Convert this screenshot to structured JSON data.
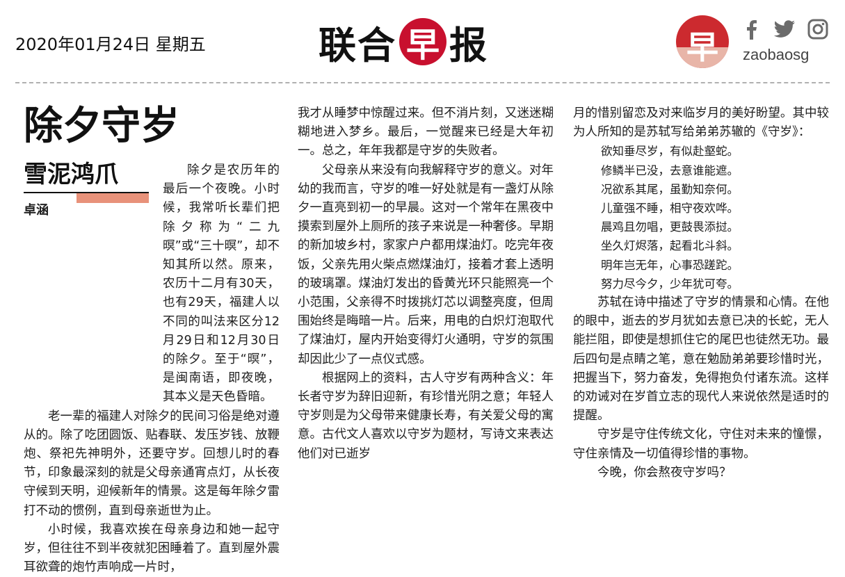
{
  "header": {
    "date": "2020年01月24日 星期五",
    "masthead": {
      "left": "联合",
      "circle": "早",
      "right": "报"
    },
    "logo_char": "早",
    "handle": "zaobaosg",
    "social_icons": [
      "facebook-icon",
      "twitter-icon",
      "instagram-icon"
    ]
  },
  "article": {
    "title": "除夕守岁",
    "column": "雪泥鸿爪",
    "author": "卓涵",
    "col1": [
      "除夕是农历年的最后一个夜晚。小时候，我常听长辈们把除夕称为“二九暝”或“三十暝”，却不知其所以然。原来，农历十二月有30天，也有29天，福建人以不同的叫法来区分12月29日和12月30日的除夕。至于“暝”，是闽南语，即夜晚，其本义是天色昏暗。",
      "老一辈的福建人对除夕的民间习俗是绝对遵从的。除了吃团圆饭、贴春联、发压岁钱、放鞭炮、祭祀先神明外，还要守岁。回想儿时的春节，印象最深刻的就是父母亲通宵点灯，从长夜守候到天明，迎候新年的情景。这是每年除夕雷打不动的惯例，直到母亲逝世为止。",
      "小时候，我喜欢挨在母亲身边和她一起守岁，但往往不到半夜就犯困睡着了。直到屋外震耳欲聋的炮竹声响成一片时，"
    ],
    "col2": [
      "我才从睡梦中惊醒过来。但不消片刻，又迷迷糊糊地进入梦乡。最后，一觉醒来已经是大年初一。总之，年年我都是守岁的失败者。",
      "父母亲从来没有向我解释守岁的意义。对年幼的我而言，守岁的唯一好处就是有一盏灯从除夕一直亮到初一的早晨。这对一个常年在黑夜中摸索到屋外上厕所的孩子来说是一种奢侈。早期的新加坡乡村，家家户户都用煤油灯。吃完年夜饭，父亲先用火柴点燃煤油灯，接着才套上透明的玻璃罩。煤油灯发出的昏黄光环只能照亮一个小范围，父亲得不时拨挑灯芯以调整亮度，但周围始终是晦暗一片。后来，用电的白炽灯泡取代了煤油灯，屋内开始变得灯火通明，守岁的氛围却因此少了一点仪式感。",
      "根据网上的资料，古人守岁有两种含义：年长者守岁为辞旧迎新，有珍惜光阴之意；年轻人守岁则是为父母带来健康长寿，有关爱父母的寓意。古代文人喜欢以守岁为题材，写诗文来表达他们对已逝岁"
    ],
    "col3_intro": "月的惜别留恋及对来临岁月的美好盼望。其中较为人所知的是苏轼写给弟弟苏辙的《守岁》：",
    "poem": [
      "欲知垂尽岁，有似赴壑蛇。",
      "修鳞半已没，去意谁能遮。",
      "况欲系其尾，虽勤知奈何。",
      "儿童强不睡，相守夜欢哗。",
      "晨鸡且勿唱，更鼓畏添挝。",
      "坐久灯烬落，起看北斗斜。",
      "明年岂无年，心事恐蹉跎。",
      "努力尽今夕，少年犹可夸。"
    ],
    "col3_after": [
      "苏轼在诗中描述了守岁的情景和心情。在他的眼中，逝去的岁月犹如去意已决的长蛇，无人能拦阻，即使是想抓住它的尾巴也徒然无功。最后四句是点睛之笔，意在勉励弟弟要珍惜时光，把握当下，努力奋发，免得抱负付诸东流。这样的劝诫对在岁首立志的现代人来说依然是适时的提醒。",
      "守岁是守住传统文化，守住对未来的憧憬，守住亲情及一切值得珍惜的事物。",
      "今晚，你会熬夜守岁吗？"
    ]
  },
  "colors": {
    "brand_red": "#c8102e",
    "accent_salmon": "#e8927a"
  }
}
